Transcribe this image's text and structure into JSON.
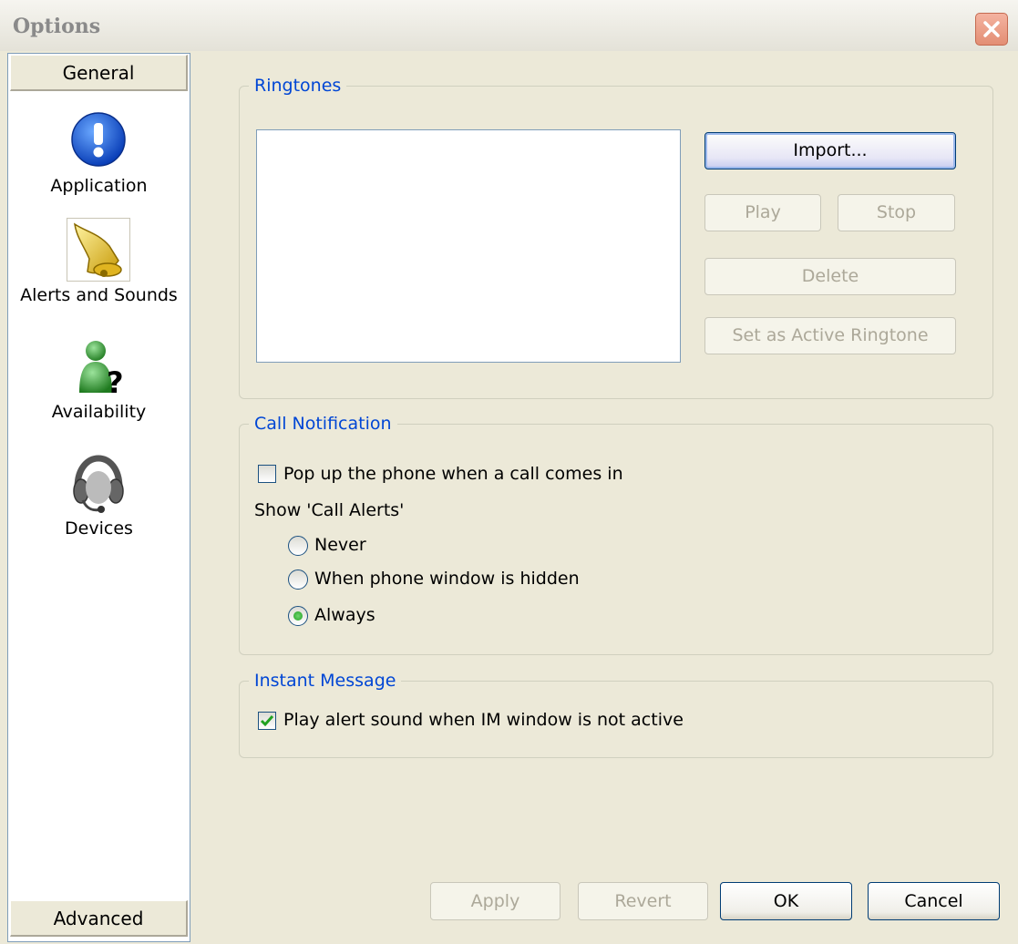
{
  "window": {
    "title": "Options"
  },
  "sidebar": {
    "header": "General",
    "footer": "Advanced",
    "items": [
      {
        "label": "Application",
        "icon": "info-icon"
      },
      {
        "label": "Alerts and Sounds",
        "icon": "bell-icon"
      },
      {
        "label": "Availability",
        "icon": "user-question-icon"
      },
      {
        "label": "Devices",
        "icon": "headset-icon"
      }
    ]
  },
  "ringtones": {
    "legend": "Ringtones",
    "import_label": "Import...",
    "play_label": "Play",
    "stop_label": "Stop",
    "delete_label": "Delete",
    "set_active_label": "Set as Active Ringtone"
  },
  "call_notification": {
    "legend": "Call Notification",
    "popup_label": "Pop up the phone when a call comes in",
    "popup_checked": false,
    "show_alerts_label": "Show 'Call Alerts'",
    "options": [
      "Never",
      "When phone window is hidden",
      "Always"
    ],
    "selected": "Always"
  },
  "instant_message": {
    "legend": "Instant Message",
    "alert_label": "Play alert sound when IM window is not active",
    "alert_checked": true
  },
  "footer": {
    "apply_label": "Apply",
    "revert_label": "Revert",
    "ok_label": "OK",
    "cancel_label": "Cancel"
  },
  "colors": {
    "legend_text": "#0046d5",
    "dialog_background": "#ece9d8",
    "checkmark": "#21a121"
  }
}
